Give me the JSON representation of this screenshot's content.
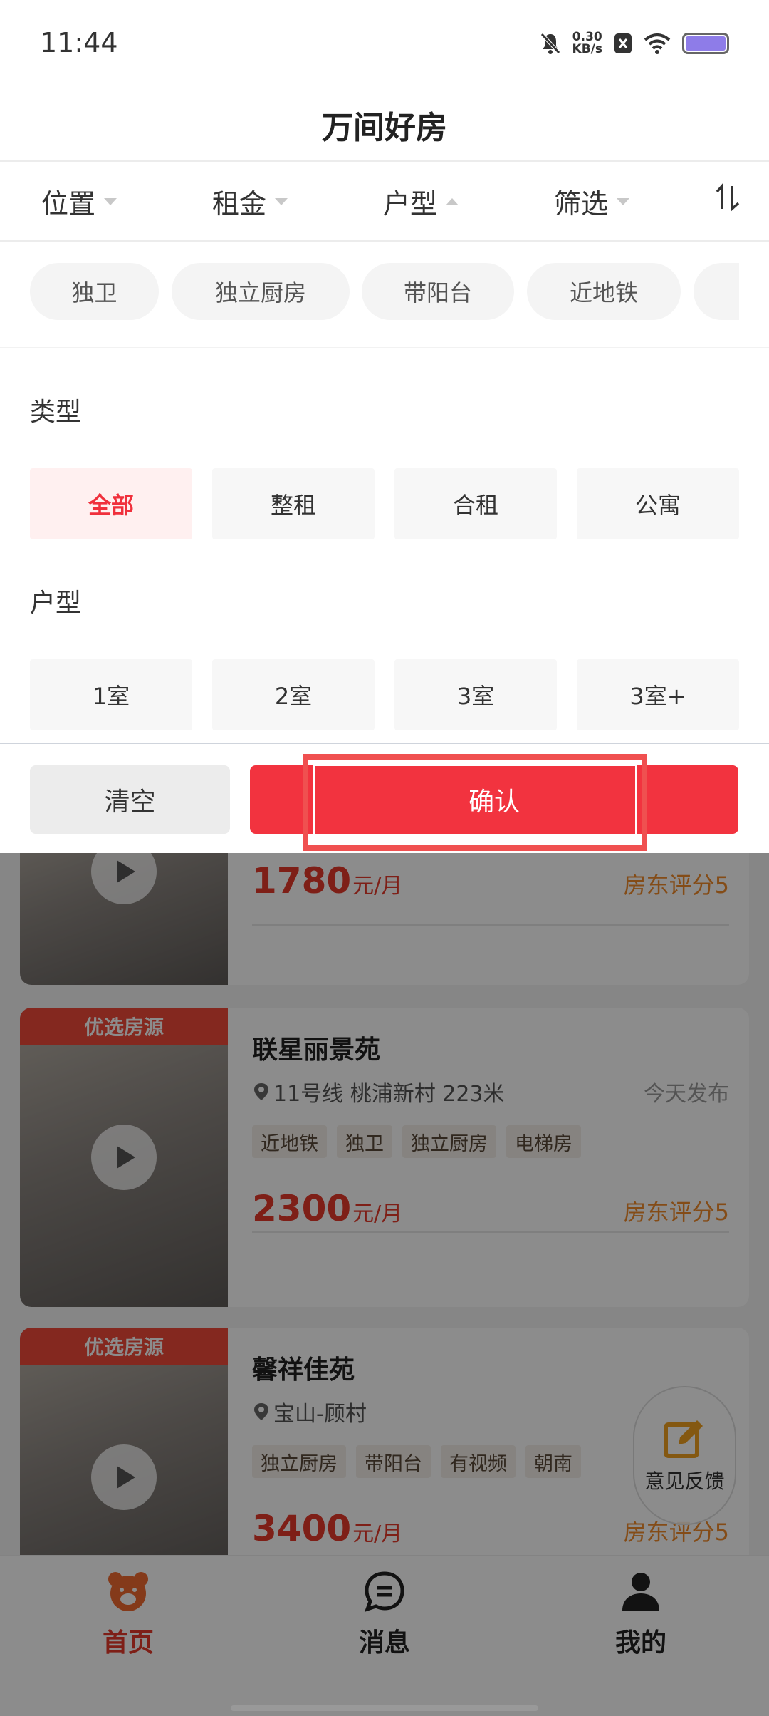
{
  "status_bar": {
    "time": "11:44",
    "net_speed_value": "0.30",
    "net_speed_unit": "KB/s"
  },
  "header": {
    "title": "万间好房"
  },
  "filter_tabs": [
    {
      "label": "位置",
      "state": "collapsed"
    },
    {
      "label": "租金",
      "state": "collapsed"
    },
    {
      "label": "户型",
      "state": "expanded"
    },
    {
      "label": "筛选",
      "state": "collapsed"
    }
  ],
  "sort_icon": "sort-icon",
  "quick_chips": [
    "独卫",
    "独立厨房",
    "带阳台",
    "近地铁"
  ],
  "panel": {
    "type_heading": "类型",
    "type_options": [
      "全部",
      "整租",
      "合租",
      "公寓"
    ],
    "type_selected": "全部",
    "layout_heading": "户型",
    "layout_options": [
      "1室",
      "2室",
      "3室",
      "3室+"
    ]
  },
  "actions": {
    "clear_label": "清空",
    "confirm_label": "确认"
  },
  "listings": [
    {
      "price": "1780",
      "price_unit": "元/月",
      "score": "房东评分5"
    },
    {
      "badge": "优选房源",
      "title": "联星丽景苑",
      "location": "11号线 桃浦新村 223米",
      "date": "今天发布",
      "tags": [
        "近地铁",
        "独卫",
        "独立厨房",
        "电梯房"
      ],
      "price": "2300",
      "price_unit": "元/月",
      "score": "房东评分5"
    },
    {
      "badge": "优选房源",
      "title": "馨祥佳苑",
      "location": "宝山-顾村",
      "tags": [
        "独立厨房",
        "带阳台",
        "有视频",
        "朝南"
      ],
      "price": "3400",
      "price_unit": "元/月",
      "score": "房东评分5"
    }
  ],
  "feedback": {
    "label": "意见反馈"
  },
  "bottom_nav": [
    {
      "label": "首页",
      "icon": "bear-home-icon",
      "active": true
    },
    {
      "label": "消息",
      "icon": "message-icon",
      "active": false
    },
    {
      "label": "我的",
      "icon": "person-icon",
      "active": false
    }
  ],
  "colors": {
    "accent": "#f2333f",
    "price": "#e53a2a",
    "score": "#f08a2a",
    "badge": "#f04a3a"
  }
}
